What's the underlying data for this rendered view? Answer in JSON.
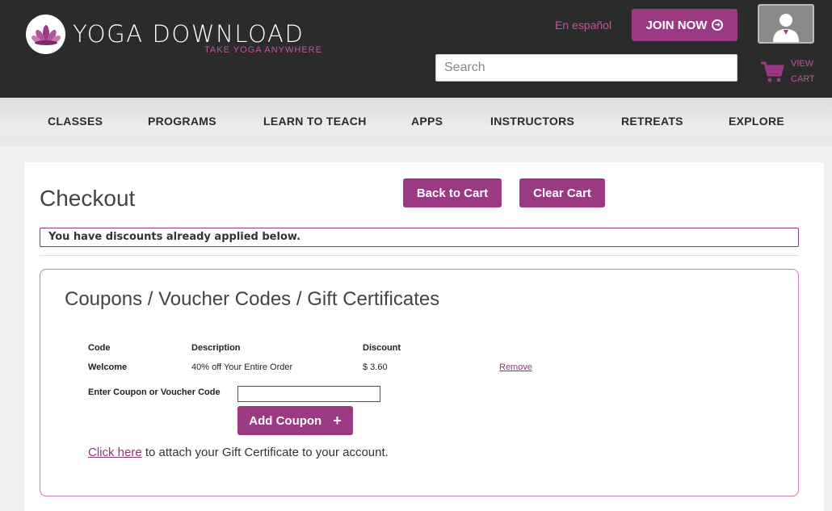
{
  "header": {
    "brand_title": "YOGA DOWNLOAD",
    "brand_tagline": "TAKE YOGA ANYWHERE",
    "language_link": "En español",
    "join_label": "JOIN NOW",
    "search_placeholder": "Search",
    "cart_label_line1": "VIEW",
    "cart_label_line2": "CART"
  },
  "nav": {
    "items": [
      {
        "label": "CLASSES"
      },
      {
        "label": "PROGRAMS"
      },
      {
        "label": "LEARN TO TEACH"
      },
      {
        "label": "APPS"
      },
      {
        "label": "INSTRUCTORS"
      },
      {
        "label": "RETREATS"
      },
      {
        "label": "EXPLORE"
      }
    ]
  },
  "checkout": {
    "title": "Checkout",
    "back_to_cart_label": "Back to Cart",
    "clear_cart_label": "Clear Cart",
    "notice": "You have discounts already applied below."
  },
  "coupons": {
    "title": "Coupons / Voucher Codes / Gift Certificates",
    "columns": {
      "code": "Code",
      "description": "Description",
      "discount": "Discount"
    },
    "rows": [
      {
        "code": "Welcome",
        "description": "40% off Your Entire Order",
        "discount": "$ 3.60",
        "action": "Remove"
      }
    ],
    "enter_label": "Enter Coupon or Voucher Code",
    "coupon_value": "",
    "add_coupon_label": "Add Coupon",
    "attach_link_text": "Click here",
    "attach_suffix": " to attach your Gift Certificate to your account."
  },
  "colors": {
    "brand_purple": "#9b3a82",
    "brand_pink": "#c2559c",
    "header_bg": "#2b2b2b"
  },
  "icons": {
    "logo": "lotus-icon",
    "join": "circle-arrow-icon",
    "avatar": "user-silhouette-icon",
    "cart": "shopping-cart-icon",
    "add": "plus-icon"
  }
}
